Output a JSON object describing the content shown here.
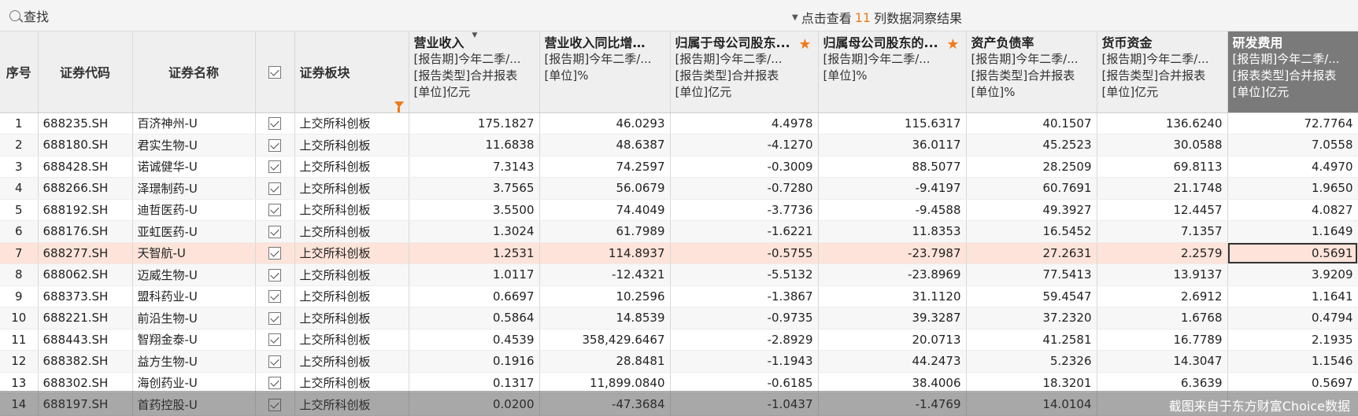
{
  "toolbar": {
    "search_label": "查找",
    "insight_prefix": "点击查看",
    "insight_count": "11",
    "insight_suffix": "列数据洞察结果"
  },
  "columns": {
    "idx": "序号",
    "code": "证券代码",
    "name": "证券名称",
    "board": "证券板块",
    "revenue": {
      "title": "营业收入",
      "lines": [
        "[报告期]今年二季/...",
        "[报告类型]合并报表",
        "[单位]亿元"
      ]
    },
    "revenue_growth": {
      "title": "营业收入同比增长率",
      "lines": [
        "[报告期]今年二季/...",
        "[单位]%"
      ]
    },
    "net_profit": {
      "title": "归属于母公司股东...",
      "lines": [
        "[报告期]今年二季/...",
        "[报告类型]合并报表",
        "[单位]亿元"
      ]
    },
    "net_profit_growth": {
      "title": "归属母公司股东的...",
      "lines": [
        "[报告期]今年二季/...",
        "[单位]%"
      ]
    },
    "debt_ratio": {
      "title": "资产负债率",
      "lines": [
        "[报告期]今年二季/...",
        "[报告类型]合并报表",
        "[单位]%"
      ]
    },
    "cash": {
      "title": "货币资金",
      "lines": [
        "[报告期]今年二季/...",
        "[报告类型]合并报表",
        "[单位]亿元"
      ]
    },
    "rd": {
      "title": "研发费用",
      "lines": [
        "[报告期]今年二季/...",
        "[报表类型]合并报表",
        "[单位]亿元"
      ]
    }
  },
  "rows": [
    [
      "1",
      "688235.SH",
      "百济神州-U",
      "上交所科创板",
      "175.1827",
      "46.0293",
      "4.4978",
      "115.6317",
      "40.1507",
      "136.6240",
      "72.7764"
    ],
    [
      "2",
      "688180.SH",
      "君实生物-U",
      "上交所科创板",
      "11.6838",
      "48.6387",
      "-4.1270",
      "36.0117",
      "45.2523",
      "30.0588",
      "7.0558"
    ],
    [
      "3",
      "688428.SH",
      "诺诚健华-U",
      "上交所科创板",
      "7.3143",
      "74.2597",
      "-0.3009",
      "88.5077",
      "28.2509",
      "69.8113",
      "4.4970"
    ],
    [
      "4",
      "688266.SH",
      "泽璟制药-U",
      "上交所科创板",
      "3.7565",
      "56.0679",
      "-0.7280",
      "-9.4197",
      "60.7691",
      "21.1748",
      "1.9650"
    ],
    [
      "5",
      "688192.SH",
      "迪哲医药-U",
      "上交所科创板",
      "3.5500",
      "74.4049",
      "-3.7736",
      "-9.4588",
      "49.3927",
      "12.4457",
      "4.0827"
    ],
    [
      "6",
      "688176.SH",
      "亚虹医药-U",
      "上交所科创板",
      "1.3024",
      "61.7989",
      "-1.6221",
      "11.8353",
      "16.5452",
      "7.1357",
      "1.1649"
    ],
    [
      "7",
      "688277.SH",
      "天智航-U",
      "上交所科创板",
      "1.2531",
      "114.8937",
      "-0.5755",
      "-23.7987",
      "27.2631",
      "2.2579",
      "0.5691"
    ],
    [
      "8",
      "688062.SH",
      "迈威生物-U",
      "上交所科创板",
      "1.0117",
      "-12.4321",
      "-5.5132",
      "-23.8969",
      "77.5413",
      "13.9137",
      "3.9209"
    ],
    [
      "9",
      "688373.SH",
      "盟科药业-U",
      "上交所科创板",
      "0.6697",
      "10.2596",
      "-1.3867",
      "31.1120",
      "59.4547",
      "2.6912",
      "1.1641"
    ],
    [
      "10",
      "688221.SH",
      "前沿生物-U",
      "上交所科创板",
      "0.5864",
      "14.8539",
      "-0.9735",
      "39.3287",
      "37.2320",
      "1.6768",
      "0.4794"
    ],
    [
      "11",
      "688443.SH",
      "智翔金泰-U",
      "上交所科创板",
      "0.4539",
      "358,429.6467",
      "-2.8929",
      "20.0713",
      "41.2581",
      "16.7789",
      "2.1935"
    ],
    [
      "12",
      "688382.SH",
      "益方生物-U",
      "上交所科创板",
      "0.1916",
      "28.8481",
      "-1.1943",
      "44.2473",
      "5.2326",
      "14.3047",
      "1.1546"
    ],
    [
      "13",
      "688302.SH",
      "海创药业-U",
      "上交所科创板",
      "0.1317",
      "11,899.0840",
      "-0.6185",
      "38.4006",
      "18.3201",
      "6.3639",
      "0.5697"
    ],
    [
      "14",
      "688197.SH",
      "首药控股-U",
      "上交所科创板",
      "0.0200",
      "-47.3684",
      "-1.0437",
      "-1.4769",
      "14.0104",
      "",
      ""
    ]
  ],
  "selected_row": "7",
  "watermark": "截图来自于东方财富Choice数据",
  "colors": {
    "accent": "#f07a18",
    "selected_row": "#fde3d9",
    "highlight_header": "#7a7a7a"
  }
}
